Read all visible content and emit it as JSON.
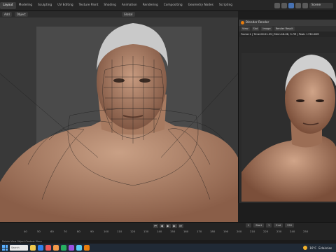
{
  "top_tabs": [
    "Layout",
    "Modeling",
    "Sculpting",
    "UV Editing",
    "Texture Paint",
    "Shading",
    "Animation",
    "Rendering",
    "Compositing",
    "Geometry Nodes",
    "Scripting"
  ],
  "active_tab": "Layout",
  "scene_name": "Scene",
  "viewport_header": {
    "mode": "Add",
    "object_menu": "Object",
    "orientation": "Global"
  },
  "render_window": {
    "title": "Blender Render",
    "toolbar": [
      "View",
      "Slot",
      "Image",
      "Render Result"
    ],
    "info": "Frame:1 | Time:00:01.35 | Mem:18.08, 3.7M | Peak: 1730.00M"
  },
  "timeline": {
    "frame_ticks": [
      "40",
      "50",
      "60",
      "70",
      "80",
      "90",
      "100",
      "110",
      "120",
      "130",
      "140",
      "150",
      "160",
      "170",
      "180",
      "190",
      "200",
      "210",
      "220",
      "230",
      "240",
      "250"
    ],
    "current_frame": "1",
    "start": "1",
    "end": "250",
    "start_label": "Start",
    "end_label": "End"
  },
  "status_text": "Rotate View   Object Context Menu",
  "taskbar": {
    "search_placeholder": "Search",
    "apps": [
      "#f2c94c",
      "#2f80ed",
      "#eb5757",
      "#f2994a",
      "#27ae60",
      "#9b51e0",
      "#56ccf2",
      "#e87d0d"
    ],
    "weather_temp": "16°C",
    "weather_desc": "Eclaircies"
  },
  "colors": {
    "accent": "#4772b3",
    "blender_orange": "#e87d0d",
    "skin": "#b78a6e",
    "hair": "#bdbdbd"
  }
}
